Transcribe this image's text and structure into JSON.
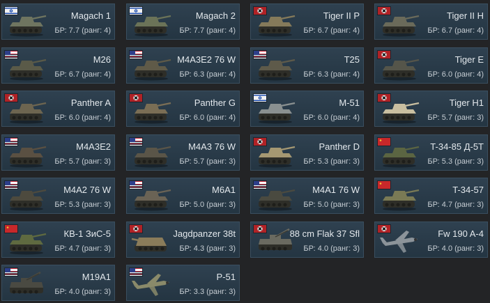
{
  "vehicles": [
    {
      "name": "Magach 1",
      "br": "БР: 7.7 (ранг: 4)",
      "flag": "israel",
      "icon": "tank-icon",
      "color": "#6f7560"
    },
    {
      "name": "Magach 2",
      "br": "БР: 7.7 (ранг: 4)",
      "flag": "israel",
      "icon": "tank-icon",
      "color": "#6b7358"
    },
    {
      "name": "Tiger II P",
      "br": "БР: 6.7 (ранг: 4)",
      "flag": "germany",
      "icon": "tank-icon",
      "color": "#857a5a"
    },
    {
      "name": "Tiger II H",
      "br": "БР: 6.7 (ранг: 4)",
      "flag": "germany",
      "icon": "tank-icon",
      "color": "#6a6a5a"
    },
    {
      "name": "M26",
      "br": "БР: 6.7 (ранг: 4)",
      "flag": "usa",
      "icon": "tank-icon",
      "color": "#5a5a48"
    },
    {
      "name": "M4A3E2 76 W",
      "br": "БР: 6.3 (ранг: 4)",
      "flag": "usa",
      "icon": "tank-icon",
      "color": "#5f5a48"
    },
    {
      "name": "T25",
      "br": "БР: 6.3 (ранг: 4)",
      "flag": "usa",
      "icon": "tank-icon",
      "color": "#5e5a4a"
    },
    {
      "name": "Tiger E",
      "br": "БР: 6.0 (ранг: 4)",
      "flag": "germany",
      "icon": "tank-icon",
      "color": "#55554a"
    },
    {
      "name": "Panther A",
      "br": "БР: 6.0 (ранг: 4)",
      "flag": "germany",
      "icon": "tank-icon",
      "color": "#6d6550"
    },
    {
      "name": "Panther G",
      "br": "БР: 6.0 (ранг: 4)",
      "flag": "germany",
      "icon": "tank-icon",
      "color": "#7a6e55"
    },
    {
      "name": "M-51",
      "br": "БР: 6.0 (ранг: 4)",
      "flag": "israel",
      "icon": "tank-icon",
      "color": "#8a9090"
    },
    {
      "name": "Tiger H1",
      "br": "БР: 5.7 (ранг: 3)",
      "flag": "germany",
      "icon": "tank-icon",
      "color": "#c9bfa0"
    },
    {
      "name": "M4A3E2",
      "br": "БР: 5.7 (ранг: 3)",
      "flag": "usa",
      "icon": "tank-icon",
      "color": "#5a5042"
    },
    {
      "name": "M4A3 76 W",
      "br": "БР: 5.7 (ранг: 3)",
      "flag": "usa",
      "icon": "tank-icon",
      "color": "#5a5548"
    },
    {
      "name": "Panther D",
      "br": "БР: 5.3 (ранг: 3)",
      "flag": "germany",
      "icon": "tank-icon",
      "color": "#a59872"
    },
    {
      "name": "T-34-85 Д-5Т",
      "br": "БР: 5.3 (ранг: 3)",
      "flag": "ussr",
      "icon": "tank-icon",
      "color": "#5b6542"
    },
    {
      "name": "M4A2 76 W",
      "br": "БР: 5.3 (ранг: 3)",
      "flag": "usa",
      "icon": "tank-icon",
      "color": "#4d4a3e"
    },
    {
      "name": "M6A1",
      "br": "БР: 5.0 (ранг: 3)",
      "flag": "usa",
      "icon": "tank-icon",
      "color": "#6a6355"
    },
    {
      "name": "M4A1 76 W",
      "br": "БР: 5.0 (ранг: 3)",
      "flag": "usa",
      "icon": "tank-icon",
      "color": "#4a4a40"
    },
    {
      "name": "T-34-57",
      "br": "БР: 4.7 (ранг: 3)",
      "flag": "ussr",
      "icon": "tank-icon",
      "color": "#7a7a55"
    },
    {
      "name": "КВ-1 ЗиС-5",
      "br": "БР: 4.7 (ранг: 3)",
      "flag": "ussr",
      "icon": "tank-icon",
      "color": "#5f6a40"
    },
    {
      "name": "Jagdpanzer 38t",
      "br": "БР: 4.3 (ранг: 3)",
      "flag": "germany",
      "icon": "tank-destroyer-icon",
      "color": "#8a7c5a"
    },
    {
      "name": "88 cm Flak 37 Sfl",
      "br": "БР: 4.0 (ранг: 3)",
      "flag": "germany",
      "icon": "spaa-icon",
      "color": "#6a6a60"
    },
    {
      "name": "Fw 190 A-4",
      "br": "БР: 4.0 (ранг: 3)",
      "flag": "germany",
      "icon": "plane-icon",
      "color": "#8c949a"
    },
    {
      "name": "M19A1",
      "br": "БР: 4.0 (ранг: 3)",
      "flag": "usa",
      "icon": "spaa-icon",
      "color": "#4a4a42"
    },
    {
      "name": "P-51",
      "br": "БР: 3.3 (ранг: 3)",
      "flag": "usa",
      "icon": "plane-icon",
      "color": "#8a8a6a"
    }
  ]
}
